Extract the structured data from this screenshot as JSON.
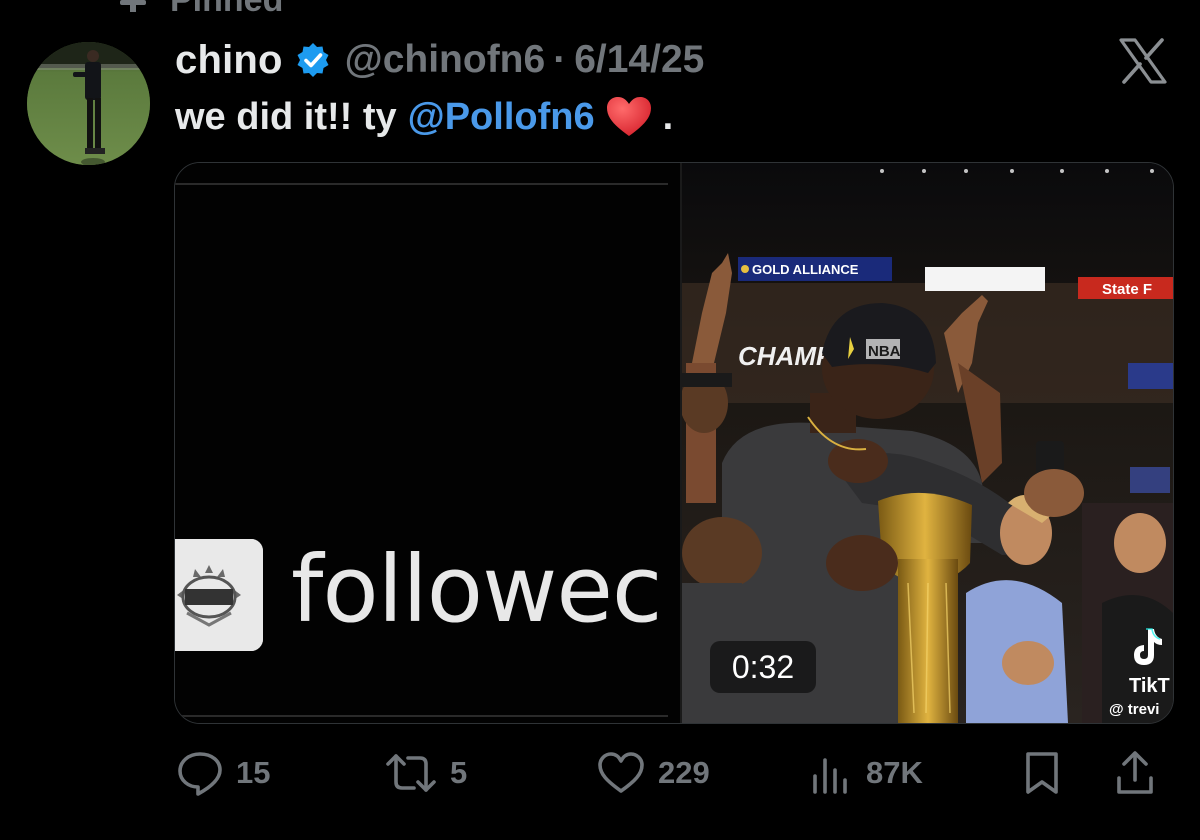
{
  "pinned": {
    "label": "Pinned"
  },
  "author": {
    "display_name": "chino",
    "handle": "@chinofn6",
    "separator": "·",
    "date": "6/14/25"
  },
  "tweet": {
    "text_start": "we did it!! ty",
    "mention": "@Pollofn6",
    "emoji": "heart-emoji",
    "text_end": "."
  },
  "media": {
    "overlay_text": "followec",
    "duration": "0:32",
    "banners": {
      "gold_alliance": "GOLD ALLIANCE",
      "champions": "CHAMPI",
      "state": "State F",
      "nba": "NBA"
    },
    "tiktok_label": "TikT",
    "tiktok_user": "@ trevi"
  },
  "actions": {
    "replies": "15",
    "reposts": "5",
    "likes": "229",
    "views": "87K"
  },
  "colors": {
    "background": "#000000",
    "text_primary": "#e7e9ea",
    "text_secondary": "#71767b",
    "link": "#4a99e9",
    "verified": "#1d9bf0",
    "heart": "#e0245e"
  }
}
